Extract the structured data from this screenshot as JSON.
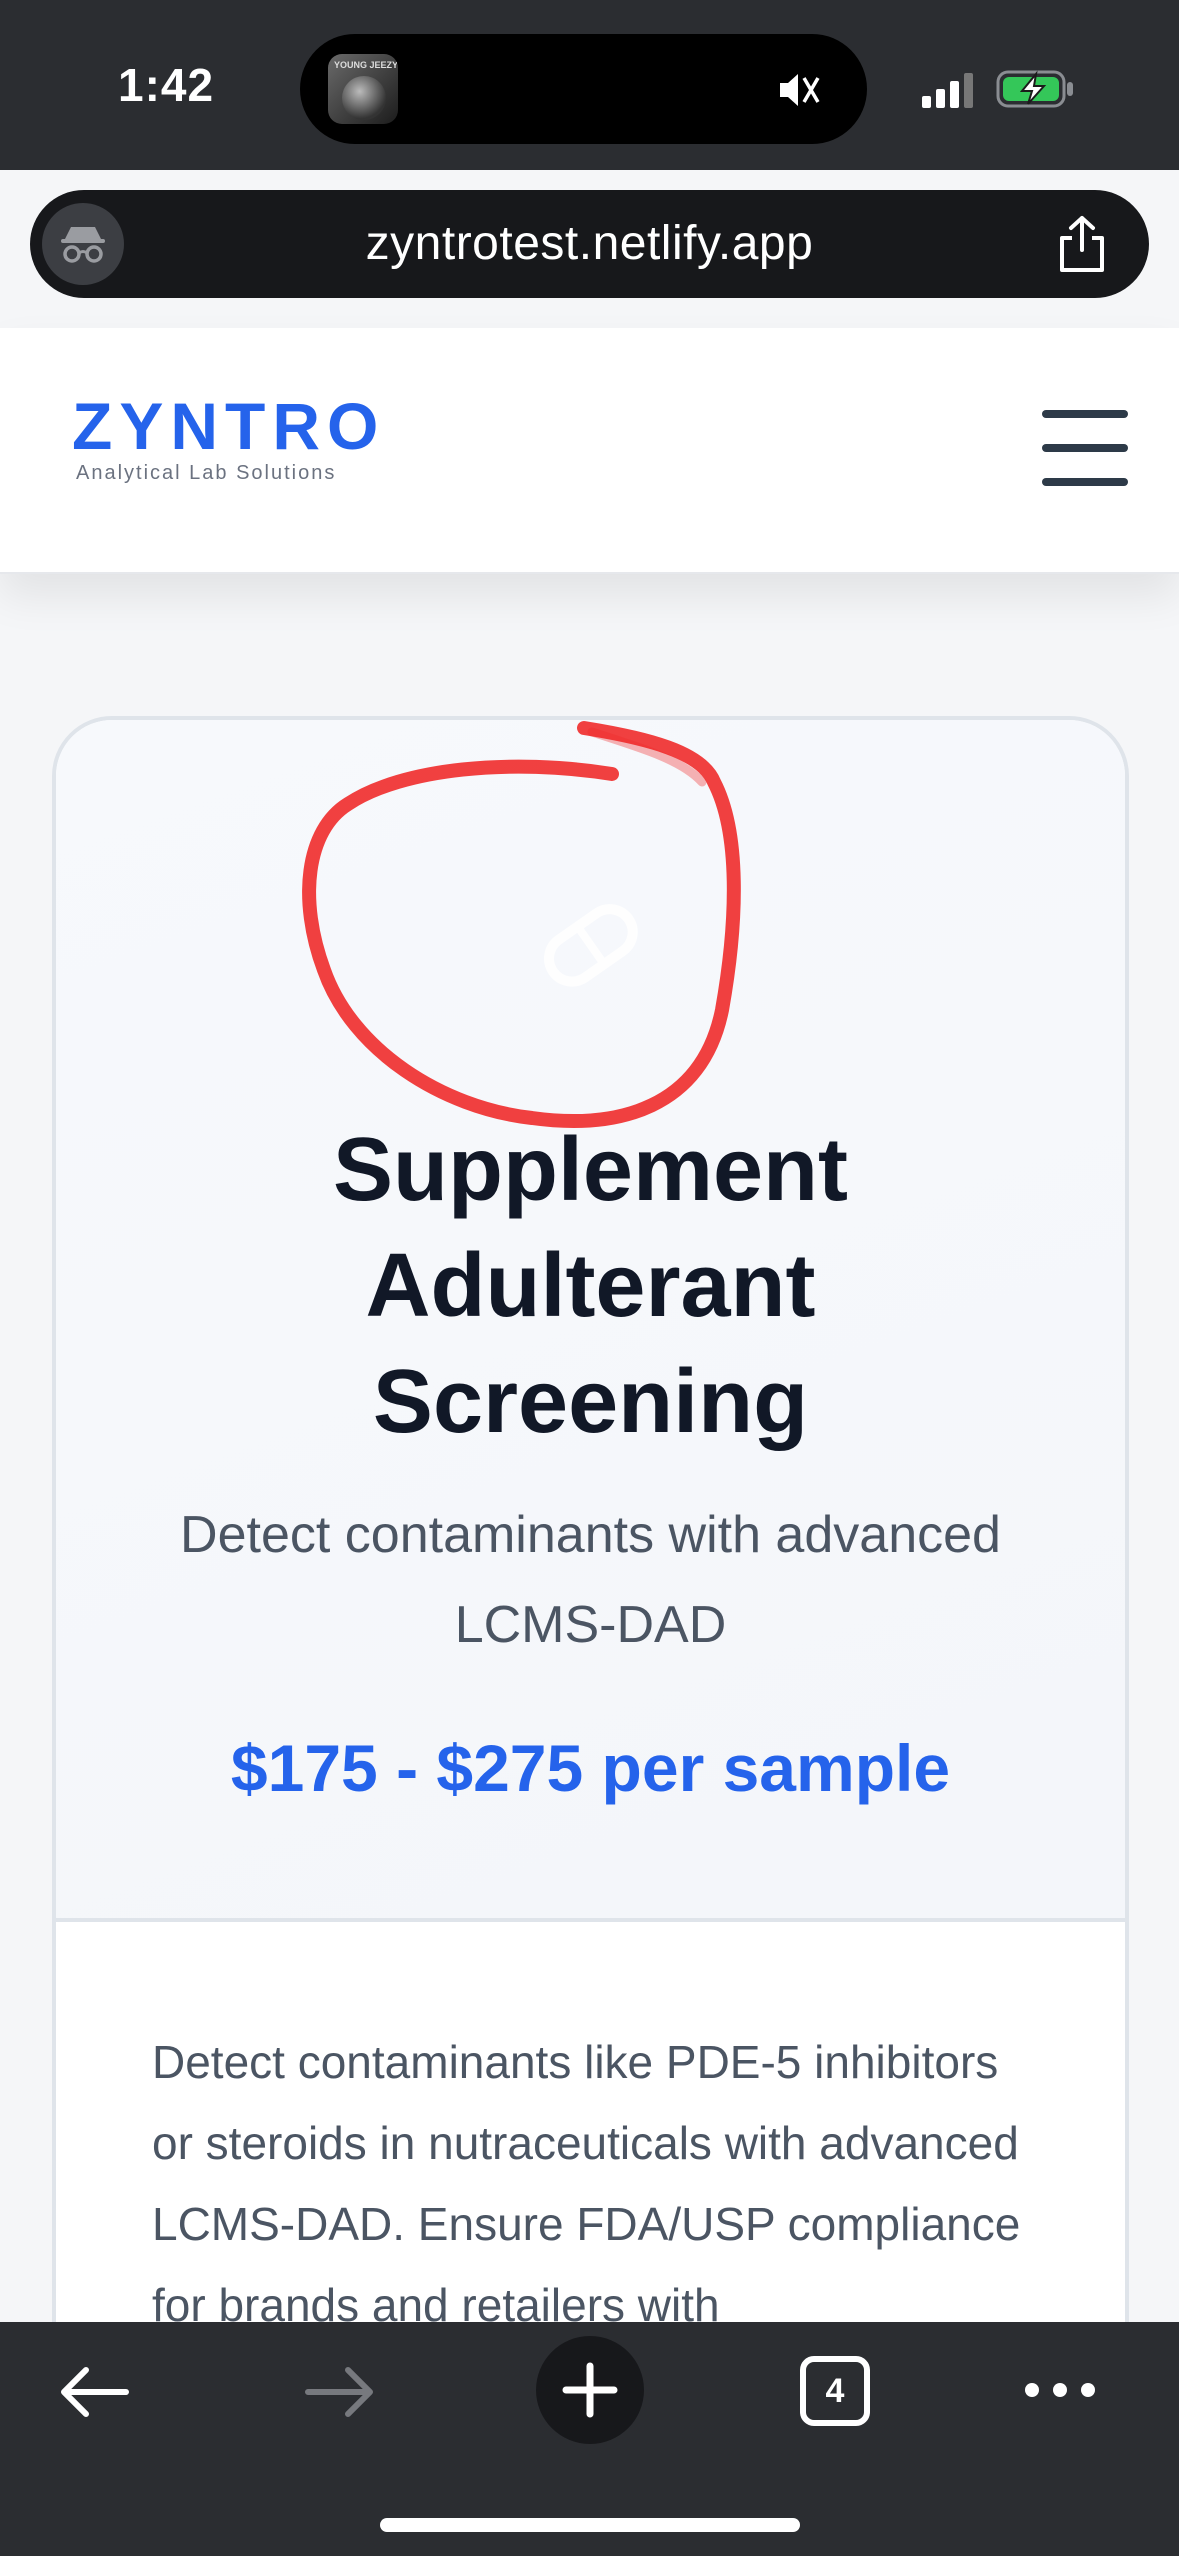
{
  "status_bar": {
    "time": "1:42",
    "now_playing_art_text": "YOUNG JEEZY",
    "ringer": "muted",
    "battery": "charging"
  },
  "browser": {
    "url": "zyntrotest.netlify.app",
    "mode": "incognito",
    "tab_count": "4"
  },
  "site": {
    "logo": "ZYNTRO",
    "tagline": "Analytical Lab Solutions"
  },
  "card": {
    "title": "Supplement Adulterant Screening",
    "subtitle": "Detect contaminants with advanced LCMS-DAD",
    "price": "$175 - $275 per sample",
    "body": "Detect contaminants like PDE-5 inhibitors or steroids in nutraceuticals with advanced LCMS-DAD. Ensure FDA/USP compliance for brands and retailers with"
  },
  "colors": {
    "accent": "#2563eb",
    "annotation": "#ef2b2b",
    "chrome": "#2b2d31"
  },
  "icons": {
    "incognito": "incognito-icon",
    "share": "share-icon",
    "menu": "hamburger-menu-icon",
    "card": "capsule-icon",
    "back": "arrow-left-icon",
    "forward": "arrow-right-icon",
    "new_tab": "plus-icon",
    "more": "more-dots-icon"
  }
}
